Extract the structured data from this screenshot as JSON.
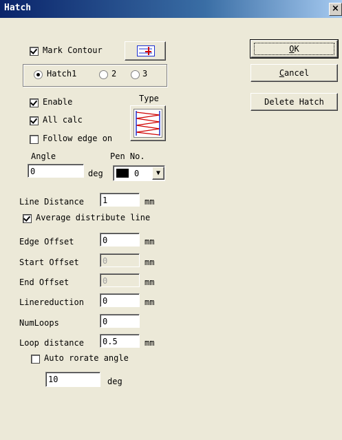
{
  "window": {
    "title": "Hatch",
    "close_glyph": "×"
  },
  "contour": {
    "mark_contour_label": "Mark Contour",
    "mark_contour_checked": true,
    "mark_contour_icon": "contour-pen-icon"
  },
  "hatch_select": {
    "options": [
      "Hatch1",
      "2",
      "3"
    ],
    "selected": "Hatch1"
  },
  "hatch": {
    "enable_label": "Enable",
    "enable_checked": true,
    "all_calc_label": "All calc",
    "all_calc_checked": true,
    "follow_edge_label": "Follow edge on",
    "follow_edge_checked": false,
    "type_label": "Type",
    "type_icon": "zigzag-hatch-icon",
    "angle_label": "Angle",
    "angle_value": "0",
    "angle_unit": "deg",
    "pen_label": "Pen No.",
    "pen_value": "0",
    "pen_color": "#000000"
  },
  "params": {
    "line_distance_label": "Line Distance",
    "line_distance_value": "1",
    "line_distance_unit": "mm",
    "average_label": "Average distribute line",
    "average_checked": true,
    "edge_offset_label": "Edge Offset",
    "edge_offset_value": "0",
    "edge_offset_unit": "mm",
    "start_offset_label": "Start Offset",
    "start_offset_value": "0",
    "start_offset_unit": "mm",
    "end_offset_label": "End Offset",
    "end_offset_value": "0",
    "end_offset_unit": "mm",
    "linereduction_label": "Linereduction",
    "linereduction_value": "0",
    "linereduction_unit": "mm",
    "numloops_label": "NumLoops",
    "numloops_value": "0",
    "loop_distance_label": "Loop distance",
    "loop_distance_value": "0.5",
    "loop_distance_unit": "mm",
    "auto_rotate_label": "Auto rorate angle",
    "auto_rotate_checked": false,
    "rotate_value": "10",
    "rotate_unit": "deg"
  },
  "buttons": {
    "ok_mnemonic": "O",
    "ok_rest": "K",
    "cancel_mnemonic": "C",
    "cancel_rest": "ancel",
    "delete_label": "Delete Hatch"
  }
}
